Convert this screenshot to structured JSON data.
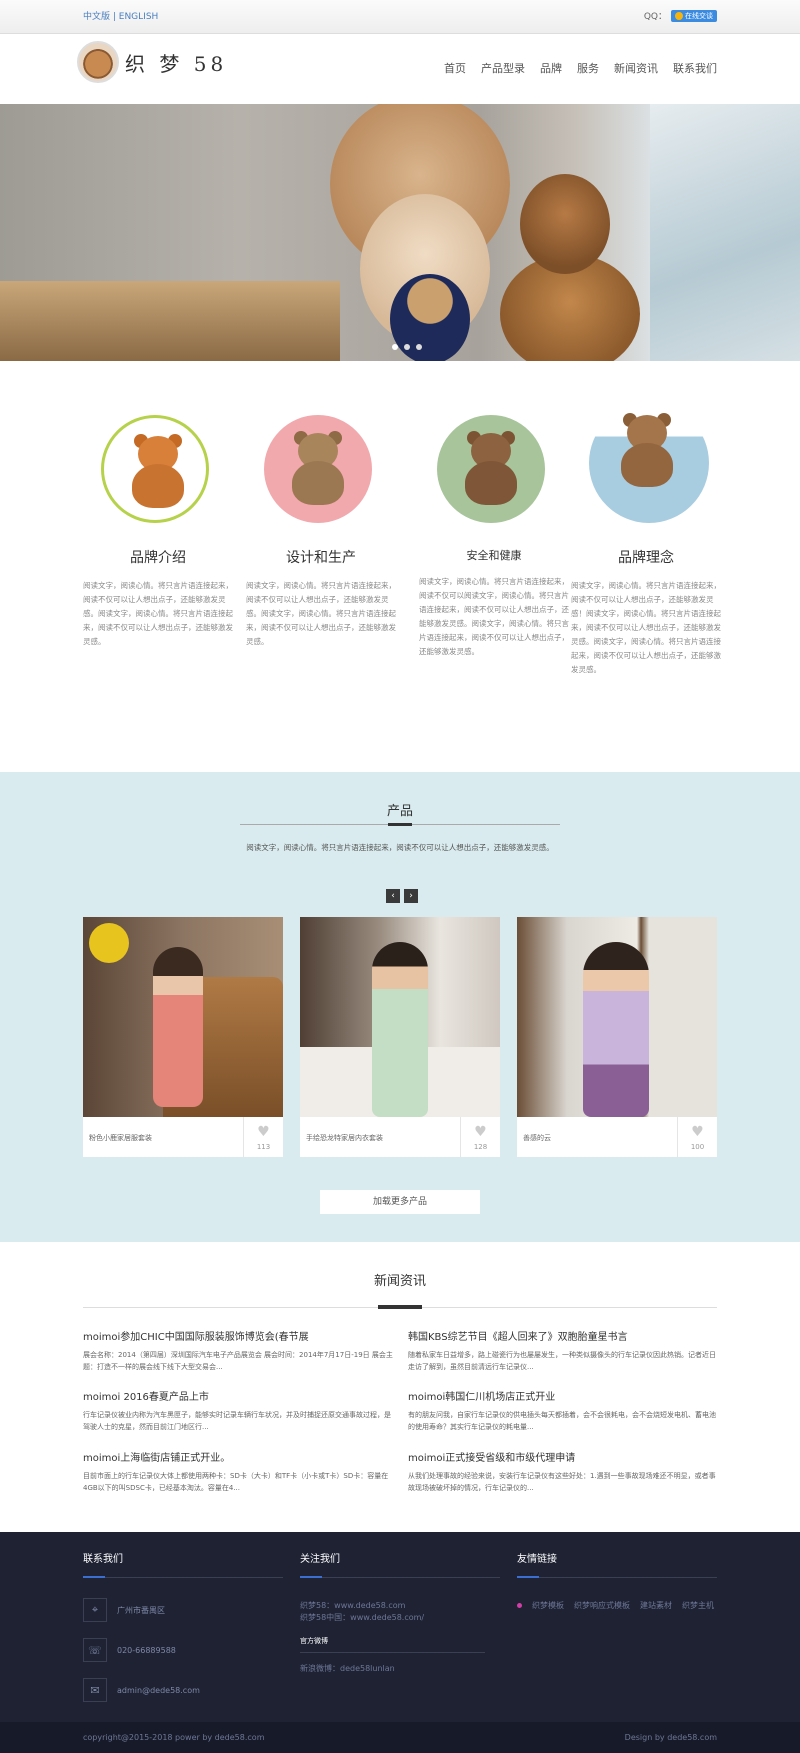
{
  "topbar": {
    "lang": "中文版 | ENGLISH",
    "qq_label": "QQ：",
    "qq_badge": "在线交谈"
  },
  "header": {
    "logo_text": "织 梦 58",
    "nav": [
      "首页",
      "产品型录",
      "品牌",
      "服务",
      "新闻资讯",
      "联系我们"
    ]
  },
  "features": [
    {
      "title": "品牌介绍",
      "text": "阅读文字，阅读心情。将只言片语连接起来，阅读不仅可以让人想出点子，还能够激发灵感。阅读文字，阅读心情。将只言片语连接起来，阅读不仅可以让人想出点子，还能够激发灵感。"
    },
    {
      "title": "设计和生产",
      "text": "阅读文字，阅读心情。将只言片语连接起来，阅读不仅可以让人想出点子，还能够激发灵感。阅读文字，阅读心情。将只言片语连接起来，阅读不仅可以让人想出点子，还能够激发灵感。"
    },
    {
      "title": "安全和健康",
      "text": "阅读文字，阅读心情。将只言片语连接起来，阅读不仅可以阅读文字，阅读心情。将只言片语连接起来，阅读不仅可以让人想出点子，还能够激发灵感。阅读文字，阅读心情。将只言片语连接起来，阅读不仅可以让人想出点子，还能够激发灵感。"
    },
    {
      "title": "品牌理念",
      "text": "阅读文字，阅读心情。将只言片语连接起来，阅读不仅可以让人想出点子，还能够激发灵感！阅读文字，阅读心情。将只言片语连接起来，阅读不仅可以让人想出点子，还能够激发灵感。阅读文字，阅读心情。将只言片语连接起来，阅读不仅可以让人想出点子，还能够激发灵感。"
    }
  ],
  "products": {
    "title": "产品",
    "desc": "阅读文字，阅读心情。将只言片语连接起来，阅读不仅可以让人想出点子，还能够激发灵感。",
    "items": [
      {
        "name": "粉色小鹿家居服套装",
        "likes": "113"
      },
      {
        "name": "手绘恐龙特家居内衣套装",
        "likes": "128"
      },
      {
        "name": "善感的云",
        "likes": "100"
      }
    ],
    "more": "加载更多产品"
  },
  "news": {
    "title": "新闻资讯",
    "items": [
      {
        "title": "moimoi参加CHIC中国国际服装服饰博览会(春节展",
        "desc": "展会名称：2014（第四届）深圳国际汽车电子产品展览会 展会时间：2014年7月17日-19日 展会主题：打造不一样的展会线下线下大型交易会..."
      },
      {
        "title": "韩国KBS综艺节目《超人回来了》双胞胎童星书言",
        "desc": "随着私家车日益增多，路上碰瓷行为也屡屡发生，一种类似摄像头的行车记录仪因此热销。记者近日走访了解到，虽然目前清远行车记录仪..."
      },
      {
        "title": "moimoi 2016春夏产品上市",
        "desc": "行车记录仪被业内称为汽车黑匣子，能够实时记录车辆行车状况，并及时捕捉还原交通事故过程，是驾驶人士的克星，然而目前江门地区行..."
      },
      {
        "title": "moimoi韩国仁川机场店正式开业",
        "desc": "有的朋友问我，自家行车记录仪的供电插头每天都插着，会不会很耗电，会不会烧短发电机、蓄电池的使用寿命？其实行车记录仪的耗电量..."
      },
      {
        "title": "moimoi上海临街店铺正式开业。",
        "desc": "目前市面上的行车记录仪大体上都使用两种卡：SD卡（大卡）和TF卡（小卡或T卡）SD卡：容量在4GB以下的叫SDSC卡，已经基本淘汰。容量在4..."
      },
      {
        "title": "moimoi正式接受省级和市级代理申请",
        "desc": "从我们处理事故的经验来说，安装行车记录仪有这些好处：1.遇到一些事故现场难还不明显，或者事故现场被破坏掉的情况，行车记录仪的..."
      }
    ]
  },
  "footer": {
    "contact_title": "联系我们",
    "address": "广州市番禺区",
    "phone": "020-66889588",
    "email": "admin@dede58.com",
    "follow_title": "关注我们",
    "site1": "织梦58：www.dede58.com",
    "site2": "织梦58中国：www.dede58.com/",
    "weibo_title": "官方微博",
    "weibo": "新浪微博：dede58lunlan",
    "links_title": "友情链接",
    "links": [
      "织梦模板",
      "织梦响应式模板",
      "建站素材",
      "织梦主机"
    ],
    "copyright": "copyright@2015-2018 power by dede58.com",
    "design": "Design by dede58.com"
  },
  "colors": {
    "accent": "#3b6ed1",
    "product_bg": "#d9ebee",
    "footer_bg": "#1e2233"
  }
}
